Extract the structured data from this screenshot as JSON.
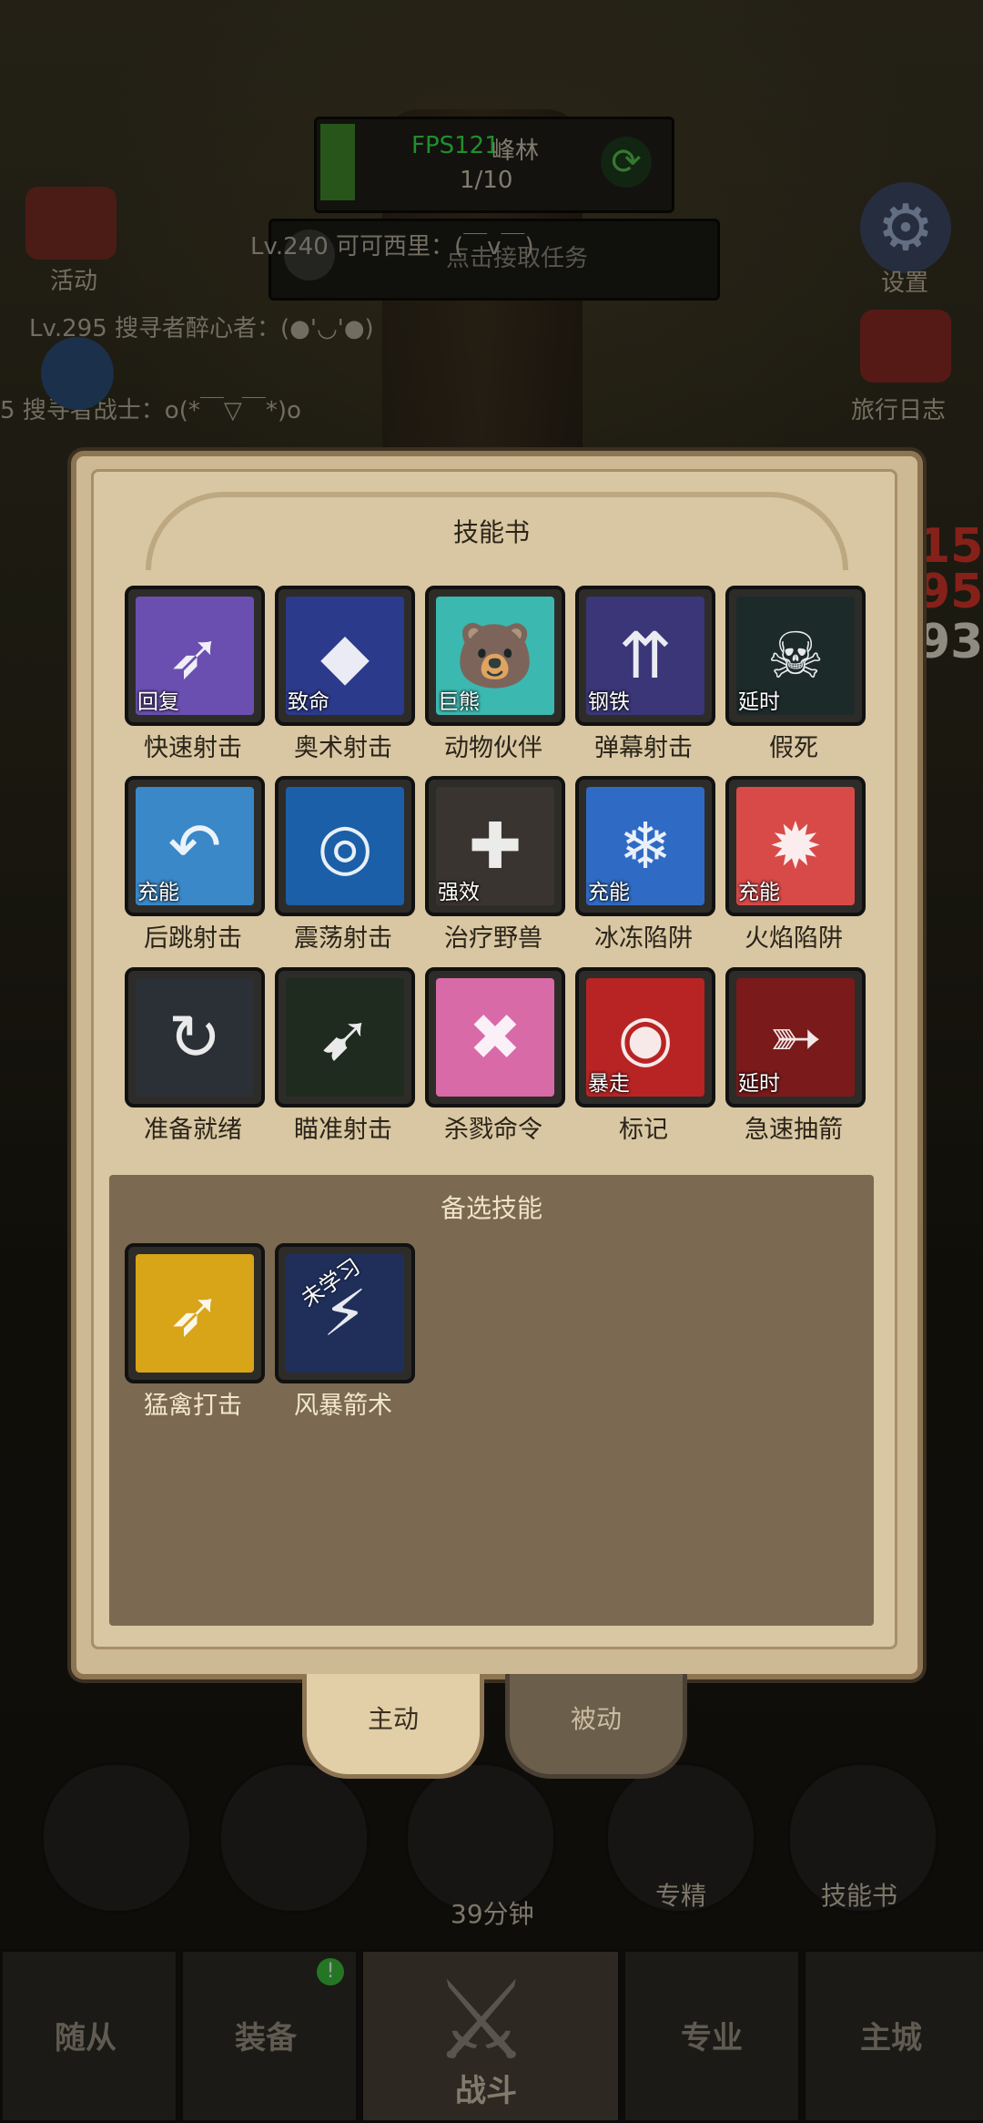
{
  "topbar": {
    "fps": "FPS121",
    "map_name": "峰林",
    "progress": "1/10",
    "task_prompt": "点击接取任务"
  },
  "chat": [
    "Lv.240 可可西里：(￣v￣)",
    "Lv.295 搜寻者醉心者：(●'◡'●)",
    "5 搜寻者战士：o(*￣▽￣*)o"
  ],
  "side": {
    "activity": "活动",
    "settings": "设置",
    "travel_log": "旅行日志"
  },
  "dialog": {
    "title": "技能书",
    "skills": [
      {
        "name": "快速射击",
        "tag": "回复",
        "color": "#6a4fb0",
        "icon": "arrow-icon"
      },
      {
        "name": "奥术射击",
        "tag": "致命",
        "color": "#2c3a8c",
        "icon": "arcane-arrow-icon"
      },
      {
        "name": "动物伙伴",
        "tag": "巨熊",
        "color": "#3bb8b0",
        "icon": "bear-icon"
      },
      {
        "name": "弹幕射击",
        "tag": "钢铁",
        "color": "#3a3678",
        "icon": "barrage-icon"
      },
      {
        "name": "假死",
        "tag": "延时",
        "color": "#1d2a2a",
        "icon": "skull-icon"
      },
      {
        "name": "后跳射击",
        "tag": "充能",
        "color": "#3a88c8",
        "icon": "jump-icon"
      },
      {
        "name": "震荡射击",
        "tag": "",
        "color": "#1a5fa8",
        "icon": "swirl-icon"
      },
      {
        "name": "治疗野兽",
        "tag": "强效",
        "color": "#3a3430",
        "icon": "paw-icon"
      },
      {
        "name": "冰冻陷阱",
        "tag": "充能",
        "color": "#2f6bc4",
        "icon": "ice-trap-icon"
      },
      {
        "name": "火焰陷阱",
        "tag": "充能",
        "color": "#d84a48",
        "icon": "fire-trap-icon"
      },
      {
        "name": "准备就绪",
        "tag": "",
        "color": "#2a3036",
        "icon": "ready-icon"
      },
      {
        "name": "瞄准射击",
        "tag": "",
        "color": "#1f2b1f",
        "icon": "aim-icon"
      },
      {
        "name": "杀戮命令",
        "tag": "",
        "color": "#d86aa8",
        "icon": "kill-command-icon"
      },
      {
        "name": "标记",
        "tag": "暴走",
        "color": "#b82424",
        "icon": "mark-icon"
      },
      {
        "name": "急速抽箭",
        "tag": "延时",
        "color": "#7a1a1a",
        "icon": "rapid-draw-icon"
      }
    ],
    "alt_title": "备选技能",
    "alt_skills": [
      {
        "name": "猛禽打击",
        "tag": "",
        "color": "#d8a418",
        "icon": "raptor-strike-icon"
      },
      {
        "name": "风暴箭术",
        "tag": "未学习",
        "color": "#1f2f5a",
        "icon": "storm-arrow-icon"
      }
    ]
  },
  "tabs": {
    "active": "主动",
    "passive": "被动"
  },
  "actions": {
    "timer": "39分钟",
    "specialize": "专精",
    "skill_book": "技能书"
  },
  "nav": {
    "followers": "随从",
    "equipment": "装备",
    "battle": "战斗",
    "profession": "专业",
    "main_city": "主城",
    "badge": "!"
  },
  "numbers": [
    "15",
    "95",
    "93"
  ]
}
